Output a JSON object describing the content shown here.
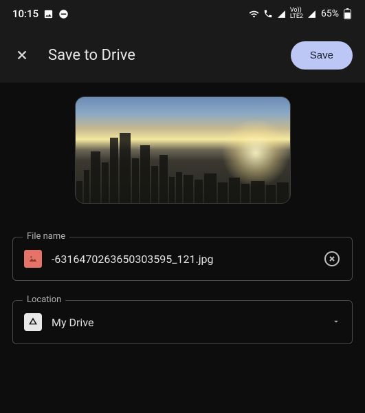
{
  "status": {
    "time": "10:15",
    "battery": "65%"
  },
  "header": {
    "title": "Save to Drive",
    "save_label": "Save"
  },
  "file": {
    "label": "File name",
    "name": "-6316470263650303595_121.jpg"
  },
  "location": {
    "label": "Location",
    "value": "My Drive"
  }
}
